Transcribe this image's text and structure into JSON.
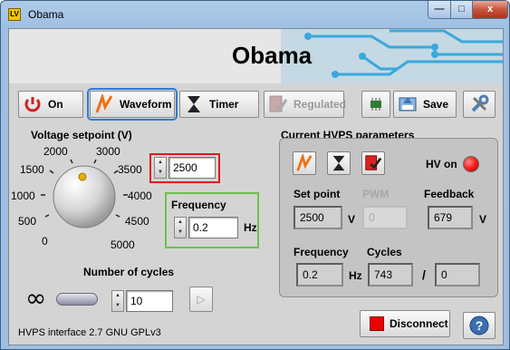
{
  "window": {
    "title": "Obama",
    "app_icon": "LV",
    "min": "—",
    "max": "□",
    "close": "x"
  },
  "app": {
    "title": "Obama"
  },
  "toolbar": {
    "on": "On",
    "waveform": "Waveform",
    "timer": "Timer",
    "regulated": "Regulated",
    "save": "Save"
  },
  "voltage": {
    "label": "Voltage setpoint (V)",
    "ticks": [
      "0",
      "500",
      "1000",
      "1500",
      "2000",
      "3000",
      "3500",
      "4000",
      "4500",
      "5000"
    ],
    "value": "2500"
  },
  "frequency": {
    "label": "Frequency",
    "value": "0.2",
    "unit": "Hz"
  },
  "cycles": {
    "label": "Number of cycles",
    "value": "10",
    "infinity": "∞"
  },
  "hvps": {
    "title": "Current HVPS parameters",
    "hv_on": "HV on",
    "setpoint_label": "Set point",
    "setpoint": "2500",
    "setpoint_unit": "V",
    "pwm_label": "PWM",
    "pwm": "0",
    "feedback_label": "Feedback",
    "feedback": "679",
    "feedback_unit": "V",
    "freq_label": "Frequency",
    "freq": "0.2",
    "freq_unit": "Hz",
    "cycles_label": "Cycles",
    "cycles": "743",
    "slash": "/",
    "cycles_total": "0"
  },
  "footer": {
    "text": "HVPS interface 2.7 GNU GPLv3"
  },
  "buttons": {
    "disconnect": "Disconnect"
  },
  "colors": {
    "highlight_red": "#e0191b",
    "highlight_green": "#6cc04a",
    "highlight_blue": "#2f7bd8",
    "led_red": "#ff1a1a",
    "waveform_orange": "#f07010"
  }
}
